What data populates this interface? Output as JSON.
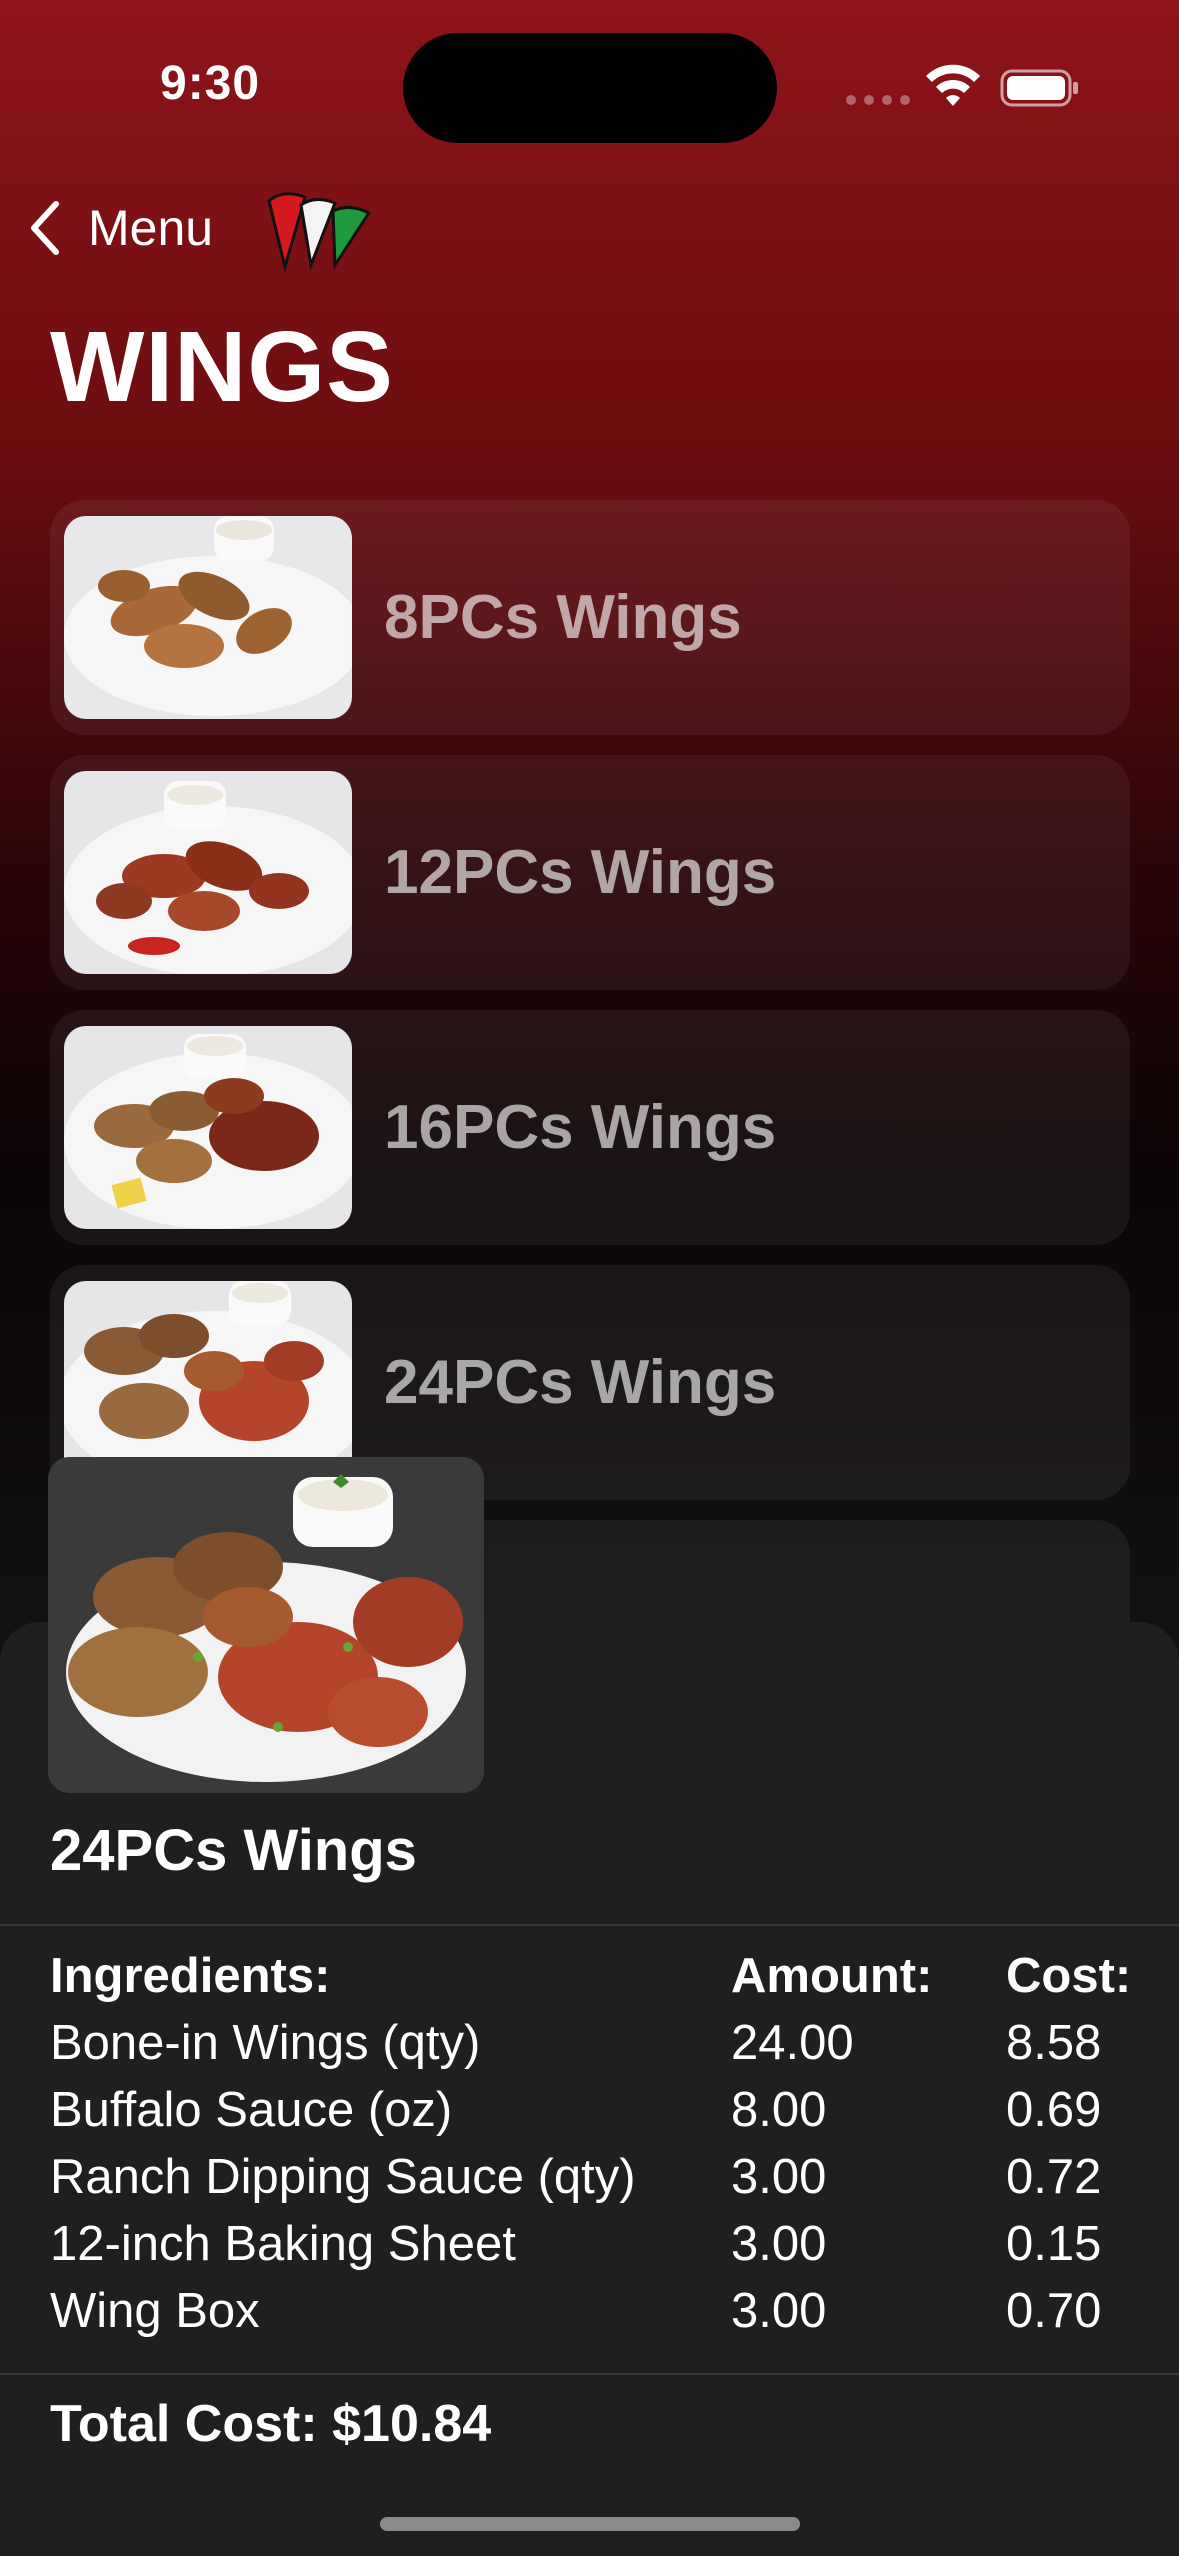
{
  "status_bar": {
    "time": "9:30"
  },
  "nav": {
    "back_label": "Menu"
  },
  "page": {
    "title": "WINGS"
  },
  "menu_items": [
    {
      "label": "8PCs Wings"
    },
    {
      "label": "12PCs Wings"
    },
    {
      "label": "16PCs Wings"
    },
    {
      "label": "24PCs Wings"
    }
  ],
  "detail": {
    "title": "24PCs Wings",
    "headers": {
      "ingredient": "Ingredients:",
      "amount": "Amount:",
      "cost": "Cost:"
    },
    "rows": [
      {
        "ingredient": "Bone-in Wings (qty)",
        "amount": "24.00",
        "cost": "8.58"
      },
      {
        "ingredient": "Buffalo Sauce (oz)",
        "amount": "8.00",
        "cost": "0.69"
      },
      {
        "ingredient": "Ranch Dipping Sauce (qty)",
        "amount": "3.00",
        "cost": "0.72"
      },
      {
        "ingredient": "12-inch Baking Sheet",
        "amount": "3.00",
        "cost": "0.15"
      },
      {
        "ingredient": "Wing Box",
        "amount": "3.00",
        "cost": "0.70"
      }
    ],
    "total": "Total Cost: $10.84"
  },
  "colors": {
    "brand_red": "#8e1419",
    "logo_green": "#1f9a3a",
    "sheet_bg": "#1f1f1f"
  }
}
